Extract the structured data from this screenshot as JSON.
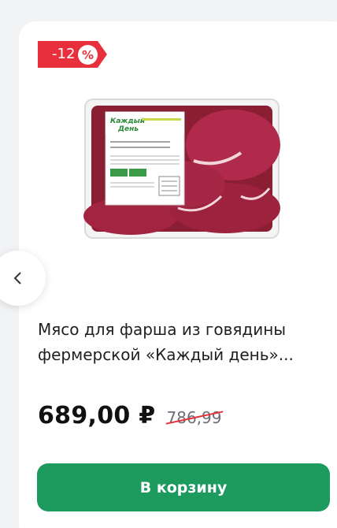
{
  "badge": {
    "discount_label": "-12",
    "percent_symbol": "%"
  },
  "colors": {
    "discount": "#e8303c",
    "button": "#1d9a5e"
  },
  "product": {
    "title": "Мясо для фарша из говядины фермерской «Каждый день»...",
    "price": "689,00 ₽",
    "old_price": "786,99",
    "package_brand": "Каждый День",
    "package_label": "Мясо для фарша из говядины \"Фермерское\""
  },
  "actions": {
    "add_to_cart": "В корзину"
  },
  "icons": {
    "prev": "chevron-left-icon",
    "percent": "percent-icon"
  }
}
